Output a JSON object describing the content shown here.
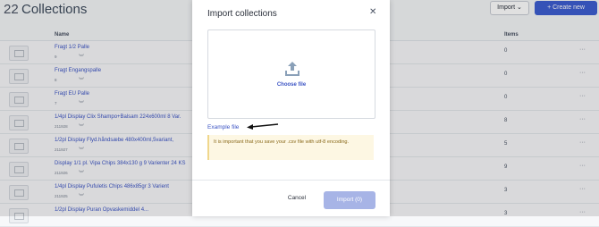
{
  "header": {
    "count": "22",
    "title": "Collections",
    "import_label": "Import",
    "create_label": "+ Create new"
  },
  "table": {
    "col_name": "Name",
    "col_items": "Items",
    "rows": [
      {
        "name": "Fragt 1/2 Palle",
        "sub": "9",
        "items": "0"
      },
      {
        "name": "Fragt Engangspalle",
        "sub": "8",
        "items": "0"
      },
      {
        "name": "Fragt EU Palle",
        "sub": "7",
        "items": "0"
      },
      {
        "name": "1/4pl Display Clix Shampo+Balsam 224x600ml 8 Var.",
        "sub": "211928",
        "items": "8"
      },
      {
        "name": "1/2pl Display Flyd.håndsæbe 480x400ml,5variant,",
        "sub": "211927",
        "items": "5"
      },
      {
        "name": "Display 1/1 pl. Vipa Chips 384x130 g 9 Varienter 24 KS",
        "sub": "211926",
        "items": "9"
      },
      {
        "name": "1/4pl Display Pufuletis Chips 486x85gr 3 Varient",
        "sub": "211925",
        "items": "3"
      },
      {
        "name": "1/2pl Display Puran Opvaskemiddel 4...",
        "sub": "",
        "items": "3"
      }
    ]
  },
  "modal": {
    "title": "Import collections",
    "choose_file": "Choose file",
    "example_file": "Example file",
    "warning": "It is important that you save your .csv file with utf-8 encoding.",
    "cancel": "Cancel",
    "import": "Import (0)"
  }
}
